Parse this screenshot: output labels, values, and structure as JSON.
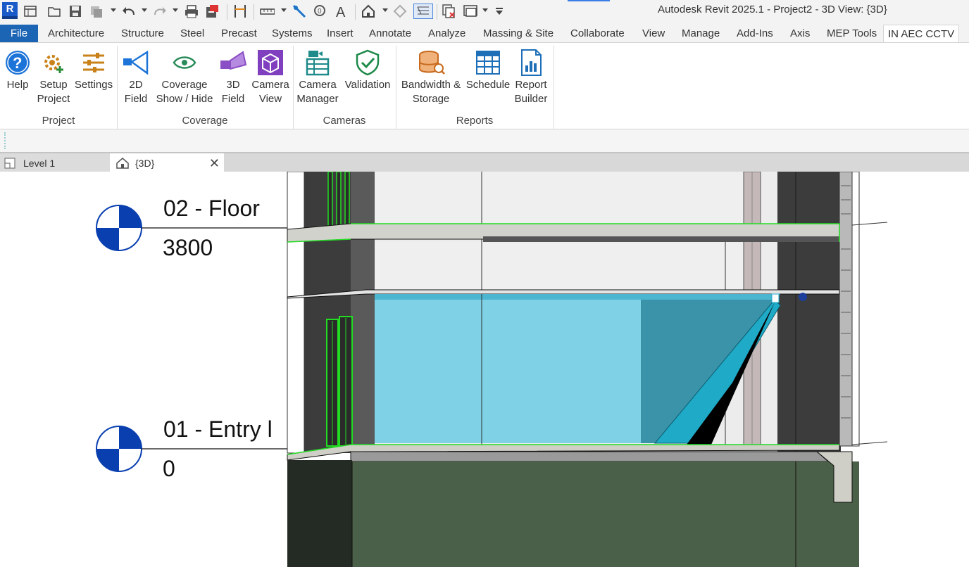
{
  "app": {
    "title": "Autodesk Revit 2025.1 - Project2 - 3D View: {3D}",
    "logo_letter": "R"
  },
  "quick_access": {
    "icons": [
      "home-menu-icon",
      "open-icon",
      "save-icon",
      "sync-icon",
      "undo-icon",
      "redo-icon",
      "print-icon",
      "export-icon",
      "measure-icon",
      "dimension-icon",
      "tag-icon",
      "text-icon",
      "3d-view-icon",
      "section-icon",
      "thin-lines-icon",
      "close-hidden-icon",
      "switch-windows-icon",
      "customize-icon"
    ]
  },
  "tabs": {
    "file": "File",
    "items": [
      "Architecture",
      "Structure",
      "Steel",
      "Precast",
      "Systems",
      "Insert",
      "Annotate",
      "Analyze",
      "Massing & Site",
      "Collaborate",
      "View",
      "Manage",
      "Add-Ins",
      "Axis",
      "MEP Tools",
      "IN AEC CCTV"
    ],
    "active": "IN AEC CCTV"
  },
  "ribbon": {
    "panels": [
      {
        "label": "Project",
        "buttons": [
          {
            "label": "Help",
            "icon": "help-icon"
          },
          {
            "label": "Setup\nProject",
            "icon": "setup-project-icon"
          },
          {
            "label": "Settings",
            "icon": "settings-icon"
          }
        ]
      },
      {
        "label": "Coverage",
        "buttons": [
          {
            "label": "2D\nField",
            "icon": "2d-field-icon"
          },
          {
            "label": "Coverage\nShow / Hide",
            "icon": "coverage-eye-icon"
          },
          {
            "label": "3D\nField",
            "icon": "3d-field-icon"
          },
          {
            "label": "Camera\nView",
            "icon": "camera-view-icon"
          }
        ]
      },
      {
        "label": "Cameras",
        "buttons": [
          {
            "label": "Camera\nManager",
            "icon": "camera-manager-icon"
          },
          {
            "label": "Validation",
            "icon": "validation-shield-icon"
          }
        ]
      },
      {
        "label": "Reports",
        "buttons": [
          {
            "label": "Bandwidth &\nStorage",
            "icon": "bandwidth-storage-icon"
          },
          {
            "label": "Schedule",
            "icon": "schedule-icon"
          },
          {
            "label": "Report\nBuilder",
            "icon": "report-builder-icon"
          }
        ]
      }
    ]
  },
  "view_tabs": [
    {
      "label": "Level 1",
      "icon": "floor-plan-icon",
      "active": false
    },
    {
      "label": "{3D}",
      "icon": "3d-house-icon",
      "active": true,
      "close_symbol": "✕"
    }
  ],
  "canvas": {
    "levels": [
      {
        "name": "02 - Floor",
        "elevation": "3800"
      },
      {
        "name": "01 - Entry l",
        "elevation": "0"
      }
    ]
  },
  "colors": {
    "file_tab": "#1c65b5",
    "level_head_blue": "#0a3fb0",
    "coverage_cyan": "#5ecbe3",
    "camera_cone": "#1faac8",
    "ground_green": "#4b6048",
    "concrete": "#c9c9c4",
    "wall_dark": "#3d3d3d",
    "edge_green": "#22dd22"
  }
}
